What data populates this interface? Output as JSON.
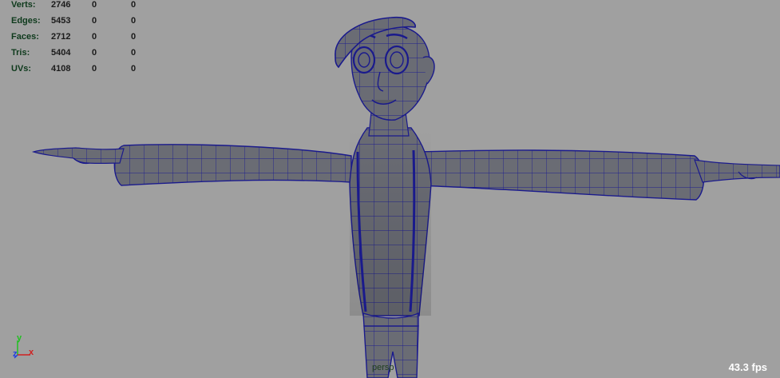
{
  "hud": {
    "rows": [
      {
        "label": "Verts:",
        "v1": "2746",
        "v2": "0",
        "v3": "0"
      },
      {
        "label": "Edges:",
        "v1": "5453",
        "v2": "0",
        "v3": "0"
      },
      {
        "label": "Faces:",
        "v1": "2712",
        "v2": "0",
        "v3": "0"
      },
      {
        "label": "Tris:",
        "v1": "5404",
        "v2": "0",
        "v3": "0"
      },
      {
        "label": "UVs:",
        "v1": "4108",
        "v2": "0",
        "v3": "0"
      }
    ]
  },
  "viewport": {
    "fps": "43.3 fps",
    "camera": "persp",
    "axis": {
      "y": "y",
      "z": "z",
      "x": "x"
    }
  },
  "colors": {
    "background": "#a0a0a0",
    "mesh_fill": "#6a6c74",
    "wireframe": "#1a1a8c",
    "hud_label": "#0e3a1c",
    "axis_x": "#d02020",
    "axis_y": "#20c020",
    "axis_z": "#2040e0"
  }
}
